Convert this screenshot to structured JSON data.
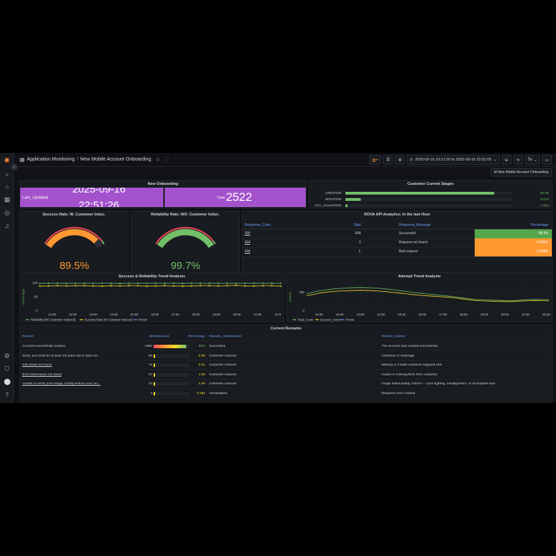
{
  "header": {
    "breadcrumb_root": "Application Monitoring",
    "breadcrumb_sep": "/",
    "title": "New Mobile Account Onboarding",
    "time_range": "2025-09-16 10:21:20 to 2025-09-16 22:02:05",
    "refresh_interval": "5s"
  },
  "variables": {
    "selected": "New Mobile Account Onboarding"
  },
  "panels": {
    "new_onboarding": {
      "title": "New Onboarding",
      "last_updated_label": "Last_Updated",
      "last_updated_value_line1": "2025-09-16",
      "last_updated_value_line2": "22:51:26",
      "total_label": "Total",
      "total_value": "2522"
    },
    "stages": {
      "title": "Customer Current Stages",
      "rows": [
        {
          "label": "CREATION",
          "value": "89.3%",
          "fraction": 0.893
        },
        {
          "label": "INITIATION",
          "value": "9.11%",
          "fraction": 0.0911
        },
        {
          "label": "KYC_VALIDATION",
          "value": "1.35%",
          "fraction": 0.0135
        }
      ]
    },
    "success_rate": {
      "title": "Success Rate: W. Customer Induc.",
      "value": "89.5%",
      "percent": 89.5
    },
    "reliability_rate": {
      "title": "Reliability Rate: WO. Customer Induc.",
      "value": "99.7%",
      "percent": 99.7
    },
    "api": {
      "title": "ROVA API Analytics: In the last Hour",
      "columns": [
        "Response_Code",
        "Total",
        "Response_Message",
        "Percentage"
      ],
      "rows": [
        {
          "code": "200",
          "total": "548",
          "message": "Successful",
          "pct": "98.9%",
          "color": "#56a64b"
        },
        {
          "code": "404",
          "total": "3",
          "message": "Request not found",
          "pct": "0.585%",
          "color": "#ff9830"
        },
        {
          "code": "400",
          "total": "1",
          "message": "Bad request",
          "pct": "0.283%",
          "color": "#ff9830"
        }
      ]
    },
    "trend": {
      "title": "Success & Reliability Trend Analysis",
      "ylabel": "Percentage",
      "yticks": [
        "100",
        "50",
        "0"
      ],
      "xticks": [
        "11:00",
        "12:00",
        "13:00",
        "14:00",
        "15:00",
        "16:00",
        "17:00",
        "18:00",
        "19:00",
        "20:00",
        "21:00",
        "22:0"
      ],
      "legend": [
        "Reliability (WO Customer Induced)",
        "Success Rate (W Customer Induced)",
        "Period"
      ]
    },
    "attempt": {
      "title": "Attempt Trend Analysis",
      "ylabel": "Volume",
      "yticks": [
        "200",
        "0"
      ],
      "xticks": [
        "11:00",
        "12:00",
        "13:00",
        "14:00",
        "15:00",
        "16:00",
        "17:00",
        "18:00",
        "19:00",
        "20:00",
        "21:00",
        "22:00"
      ],
      "legend": [
        "Total_Count",
        "Success_Count",
        "Period"
      ]
    },
    "remarks": {
      "title": "Current Remarks",
      "columns": [
        "Remark",
        "AttemptCount",
        "Percentage",
        "Remark_classification",
        "Remark_reason"
      ],
      "rows": [
        {
          "remark": "Account successfully created",
          "count": "1990",
          "pct": "89.5",
          "fraction": 0.895,
          "cls": "Successful",
          "reason": "The account was created successfully",
          "link": false
        },
        {
          "remark": "Sorry, you must be at least 18 years old to open an...",
          "count": "86",
          "pct": "3.86",
          "fraction": 0.0386,
          "cls": "Customer Induced",
          "reason": "Customer is underage",
          "link": false
        },
        {
          "remark": "NIN detail not found",
          "count": "76",
          "pct": "3.41",
          "fraction": 0.0341,
          "cls": "Customer Induced",
          "reason": "Missing or invalid customer-supplied NIN",
          "link": true
        },
        {
          "remark": "BVN Information not found",
          "count": "37",
          "pct": "1.56",
          "fraction": 0.0156,
          "cls": "Customer Induced",
          "reason": "Invalid or missing BVN from customer",
          "link": true
        },
        {
          "remark": "Unable to verify your image. Kindly ensure your fac...",
          "count": "24",
          "pct": "1.38",
          "fraction": 0.0138,
          "cls": "Customer Induced",
          "reason": "Image failed quality checks — poor lighting, misalignment, or incomplete face",
          "link": true
        },
        {
          "remark": "",
          "count": "4",
          "pct": "0.180",
          "fraction": 0.0018,
          "cls": "Unclassified",
          "reason": "Requires more context",
          "link": false
        }
      ]
    }
  },
  "colors": {
    "bg": "#111217",
    "panel": "#181b1f",
    "purple": "#a352cc",
    "green": "#73bf69",
    "orange": "#ff9830",
    "yellow": "#fade2a",
    "blue": "#6e9fff"
  }
}
